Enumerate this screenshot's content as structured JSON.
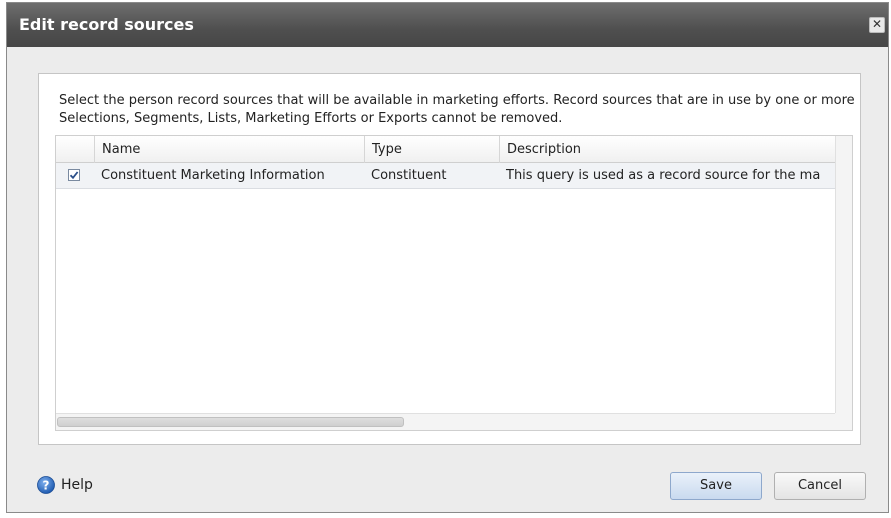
{
  "dialog": {
    "title": "Edit record sources",
    "close_glyph": "✕"
  },
  "instructions": "Select the person record sources that will be available in marketing efforts. Record sources that are in use by one or more Selections, Segments, Lists, Marketing Efforts or Exports cannot be removed.",
  "grid": {
    "columns": [
      "Name",
      "Type",
      "Description"
    ],
    "rows": [
      {
        "checked": true,
        "name": "Constituent Marketing Information",
        "type": "Constituent",
        "description": "This query is used as a record source for the ma"
      }
    ]
  },
  "footer": {
    "help_label": "Help",
    "save_label": "Save",
    "cancel_label": "Cancel"
  },
  "colors": {
    "titlebar": "#4f4f4f",
    "selected_row": "#f1f3f6",
    "help_icon": "#2f6fc4"
  },
  "icons": {
    "close": "close-icon",
    "help": "help-icon",
    "checkbox": "checkbox-checked-icon"
  }
}
